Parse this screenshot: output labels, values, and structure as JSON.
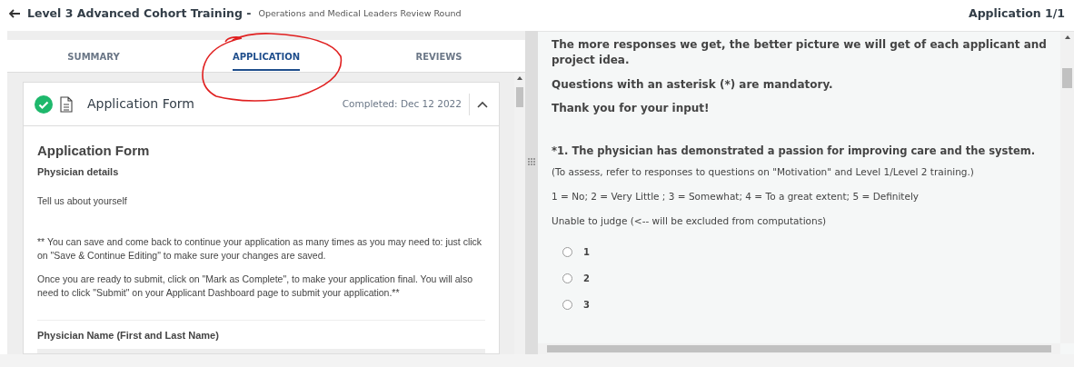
{
  "header": {
    "title": "Level 3 Advanced Cohort Training -",
    "subtitle": "Operations and Medical Leaders Review Round",
    "counter": "Application 1/1"
  },
  "tabs": [
    {
      "label": "SUMMARY",
      "selected": false
    },
    {
      "label": "APPLICATION",
      "selected": true
    },
    {
      "label": "REVIEWS",
      "selected": false
    }
  ],
  "form_card": {
    "title": "Application Form",
    "completed": true,
    "status": "Completed: Dec 12 2022",
    "expanded": true,
    "heading": "Application Form",
    "section": "Physician details",
    "intro": "Tell us about yourself",
    "paragraphs": [
      "** You can save and come back to continue your application as many times as you may need to: just click on \"Save & Continue Editing\" to make sure your changes are saved.",
      "Once you are ready to submit, click on \"Mark as Complete\", to make your application final. You will also need to click \"Submit\" on your Applicant Dashboard page to submit your application.**"
    ],
    "field_label": "Physician Name (First and Last Name)"
  },
  "review": {
    "notes": [
      "The more responses we get, the better picture we will get of each applicant and project idea.",
      "Questions with an asterisk (*) are mandatory.",
      "Thank you for your input!"
    ],
    "question": "*1. The physician has demonstrated a passion for improving care and the system.",
    "hints": [
      "(To assess, refer to responses to questions on \"Motivation\" and Level 1/Level 2 training.)",
      "1 = No; 2 = Very Little ; 3 = Somewhat; 4 = To a great extent; 5 = Definitely",
      "Unable to judge  (<-- will be excluded from computations)"
    ],
    "options": [
      {
        "label": "1",
        "selected": false
      },
      {
        "label": "2",
        "selected": false
      },
      {
        "label": "3",
        "selected": false
      }
    ]
  }
}
